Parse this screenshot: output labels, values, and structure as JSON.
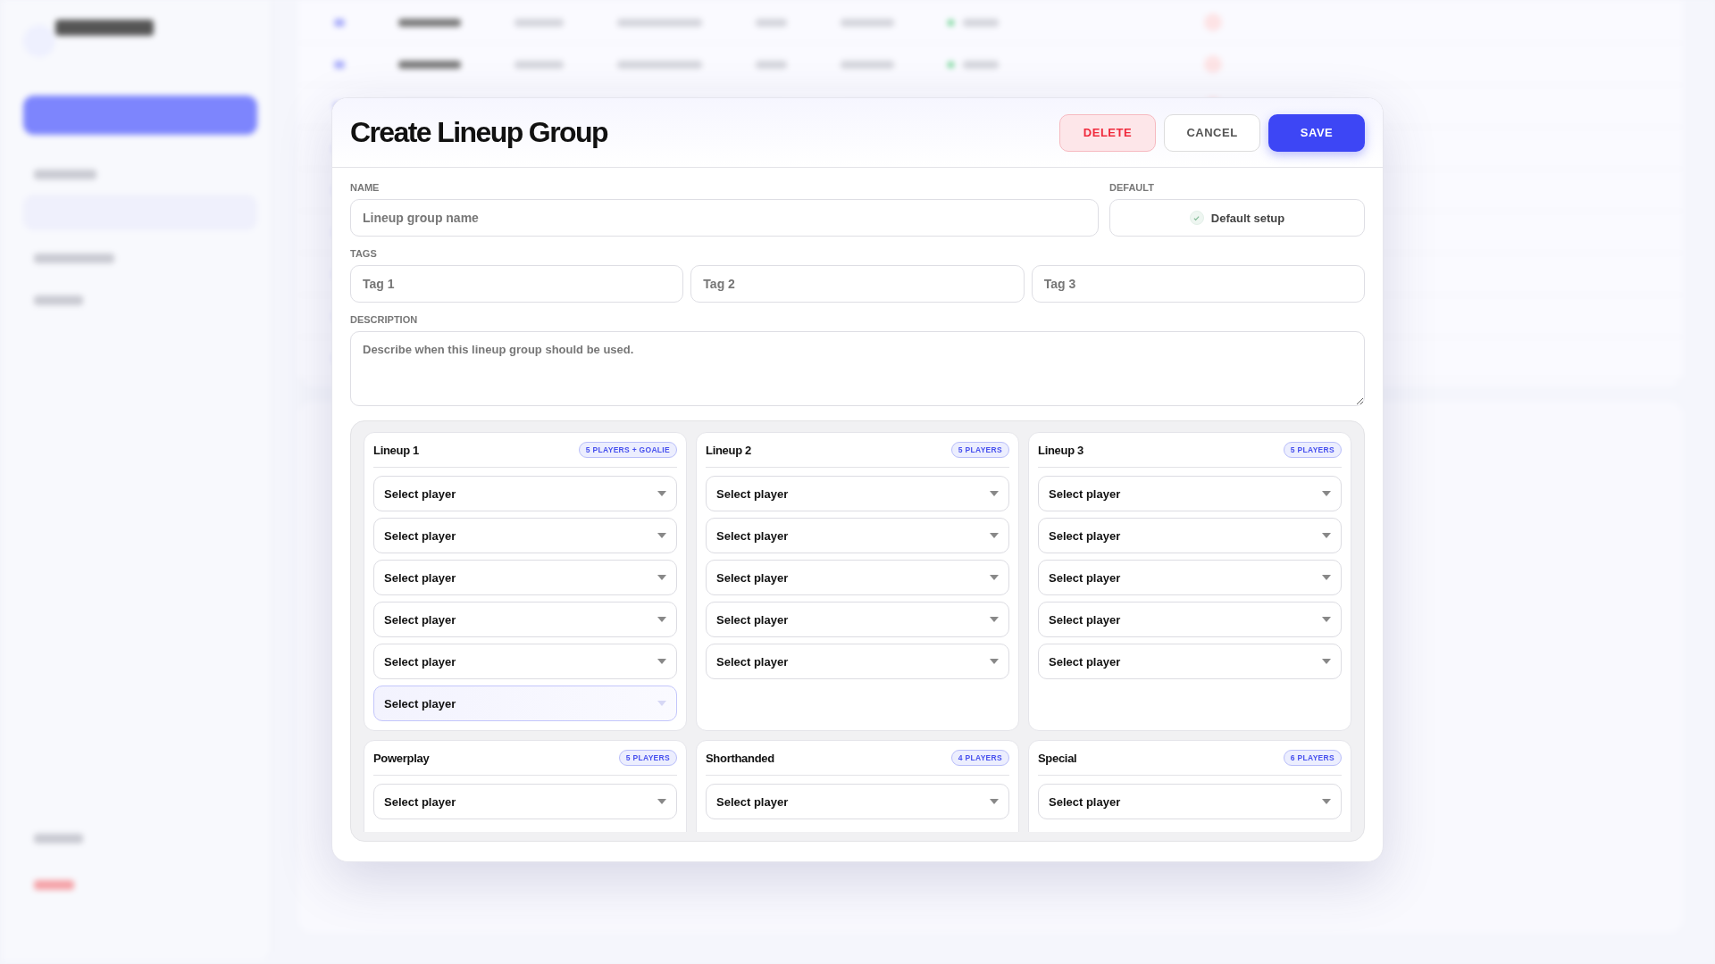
{
  "dialog": {
    "title": "Create Lineup Group",
    "buttons": [
      {
        "kind": "danger",
        "label": "DELETE"
      },
      {
        "kind": "plain",
        "label": "CANCEL"
      },
      {
        "kind": "primary",
        "label": "SAVE"
      }
    ],
    "name_label": "NAME",
    "name_placeholder": "Lineup group name",
    "default_label": "DEFAULT",
    "default_option": {
      "label": "Default setup",
      "checked": true
    },
    "tags_label": "TAGS",
    "tags": [
      {
        "placeholder": "Tag 1"
      },
      {
        "placeholder": "Tag 2"
      },
      {
        "placeholder": "Tag 3"
      }
    ],
    "description_label": "DESCRIPTION",
    "description_placeholder": "Describe when this lineup group should be used.",
    "lineups": [
      {
        "title": "Lineup 1",
        "badge": "5 PLAYERS + GOALIE",
        "selects": [
          {
            "label": "Select player",
            "highlighted": false
          },
          {
            "label": "Select player",
            "highlighted": false
          },
          {
            "label": "Select player",
            "highlighted": false
          },
          {
            "label": "Select player",
            "highlighted": false
          },
          {
            "label": "Select player",
            "highlighted": false
          },
          {
            "label": "Select player",
            "highlighted": true
          }
        ]
      },
      {
        "title": "Lineup 2",
        "badge": "5 PLAYERS",
        "selects": [
          {
            "label": "Select player",
            "highlighted": false
          },
          {
            "label": "Select player",
            "highlighted": false
          },
          {
            "label": "Select player",
            "highlighted": false
          },
          {
            "label": "Select player",
            "highlighted": false
          },
          {
            "label": "Select player",
            "highlighted": false
          }
        ]
      },
      {
        "title": "Lineup 3",
        "badge": "5 PLAYERS",
        "selects": [
          {
            "label": "Select player",
            "highlighted": false
          },
          {
            "label": "Select player",
            "highlighted": false
          },
          {
            "label": "Select player",
            "highlighted": false
          },
          {
            "label": "Select player",
            "highlighted": false
          },
          {
            "label": "Select player",
            "highlighted": false
          }
        ]
      },
      {
        "title": "Powerplay",
        "badge": "5 PLAYERS",
        "selects": [
          {
            "label": "Select player",
            "highlighted": false
          }
        ]
      },
      {
        "title": "Shorthanded",
        "badge": "4 PLAYERS",
        "selects": [
          {
            "label": "Select player",
            "highlighted": false
          }
        ]
      },
      {
        "title": "Special",
        "badge": "6 PLAYERS",
        "selects": [
          {
            "label": "Select player",
            "highlighted": false
          }
        ]
      }
    ]
  }
}
